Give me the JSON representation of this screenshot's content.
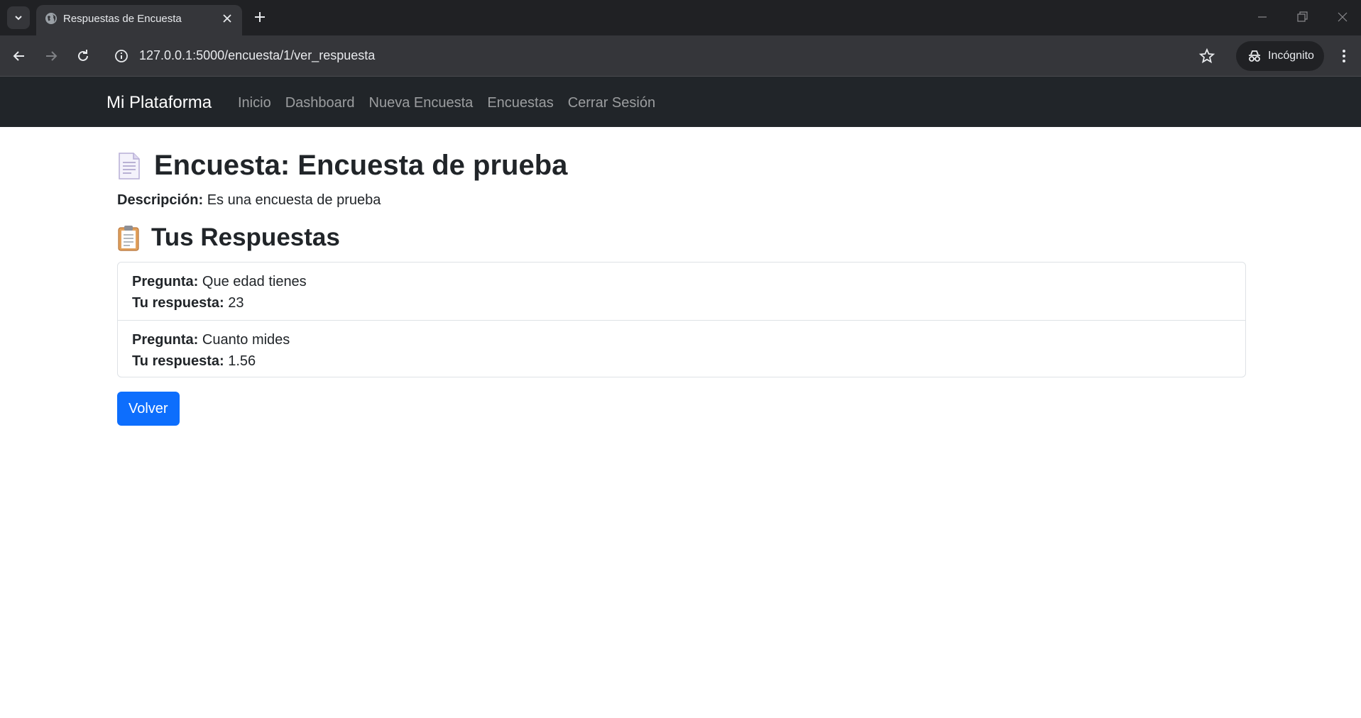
{
  "browser": {
    "tab_title": "Respuestas de Encuesta",
    "url": "127.0.0.1:5000/encuesta/1/ver_respuesta",
    "incognito_label": "Incógnito"
  },
  "navbar": {
    "brand": "Mi Plataforma",
    "links": [
      "Inicio",
      "Dashboard",
      "Nueva Encuesta",
      "Encuestas",
      "Cerrar Sesión"
    ]
  },
  "survey": {
    "title": "Encuesta: Encuesta de prueba",
    "description_label": "Descripción:",
    "description": "Es una encuesta de prueba"
  },
  "responses": {
    "heading": "Tus Respuestas",
    "question_label": "Pregunta:",
    "answer_label": "Tu respuesta:",
    "items": [
      {
        "question": "Que edad tienes",
        "answer": "23"
      },
      {
        "question": "Cuanto mides",
        "answer": "1.56"
      }
    ]
  },
  "actions": {
    "back_label": "Volver"
  },
  "colors": {
    "primary": "#0d6efd",
    "navbar_bg": "#212529",
    "chrome_bg": "#35363a"
  }
}
